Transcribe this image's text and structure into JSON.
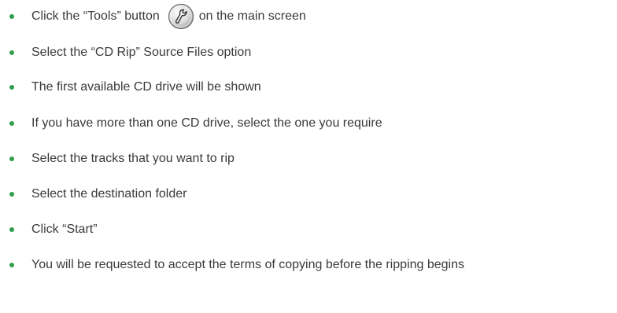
{
  "bullet_color": "#2f9e4d",
  "steps": [
    {
      "before_icon": "Click the “Tools” button",
      "icon": "tools-wrench-icon",
      "after_icon": "on the main screen"
    },
    {
      "text": "Select the “CD Rip”  Source Files option"
    },
    {
      "text": "The first available CD drive will be shown"
    },
    {
      "text": "If you have more than one CD drive, select the one you require"
    },
    {
      "text": "Select the tracks that you want to rip"
    },
    {
      "text": "Select the destination folder"
    },
    {
      "text": "Click  “Start”"
    },
    {
      "text": "You will be requested to accept the terms of copying before the ripping begins"
    }
  ]
}
